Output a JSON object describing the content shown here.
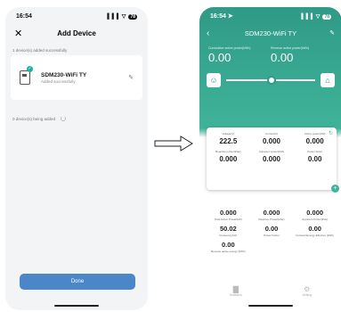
{
  "left": {
    "time": "16:54",
    "signal": "▐▐▐ ▽",
    "battery": "78",
    "close_glyph": "✕",
    "title": "Add Device",
    "section_added": "1 device(s) added successfully",
    "device": {
      "name": "SDM230-WiFi TY",
      "status": "Added successfully"
    },
    "check_glyph": "✓",
    "edit_glyph": "✎",
    "section_adding": "0 device(s) being added",
    "done_label": "Done"
  },
  "right": {
    "time": "16:54 ➤",
    "signal": "▐▐▐ ▽",
    "battery": "78",
    "back_glyph": "‹",
    "title": "SDM230-WiFi TY",
    "edit_glyph": "✎",
    "kpi1": {
      "label": "Cumulative active power(kWh)",
      "value": "0.00"
    },
    "kpi2": {
      "label": "Reverse active power(kWh)",
      "value": "0.00"
    },
    "slider": {
      "left_icon": "☺",
      "right_icon": "⌂",
      "level": 0.46
    },
    "refresh_glyph": "↻",
    "plus_glyph": "+",
    "panel_row1": [
      {
        "label": "Voltage(V)",
        "value": "222.5"
      },
      {
        "label": "Current(A)",
        "value": "0.000"
      },
      {
        "label": "Active power(kW)",
        "value": "0.000"
      }
    ],
    "panel_row2": [
      {
        "label": "Reactive power(kVar)",
        "value": "0.000"
      },
      {
        "label": "Apparent power(kVA)",
        "value": "0.000"
      },
      {
        "label": "Power factor",
        "value": "0.00"
      }
    ],
    "lower_row1": [
      {
        "value": "0.000",
        "label": "Total Active Power(kW)"
      },
      {
        "value": "0.000",
        "label": "Reactive Power(kVar)"
      },
      {
        "value": "0.000",
        "label": "Apparent Power(kVA)"
      }
    ],
    "lower_row2": [
      {
        "value": "50.02",
        "label": "Frequency(Hz)"
      },
      {
        "value": "0.00",
        "label": "Power Factor"
      },
      {
        "value": "0.00",
        "label": "Forward Energy Effective (kWh)"
      }
    ],
    "lower_row3": [
      {
        "value": "0.00",
        "label": "Reverse active energy (kWh)"
      }
    ],
    "tabs": [
      {
        "icon": "▇",
        "label": "Statistics"
      },
      {
        "icon": "⚙",
        "label": "Setting"
      }
    ]
  },
  "colors": {
    "accent": "#3fb39a",
    "done_button": "#4b86c9"
  }
}
